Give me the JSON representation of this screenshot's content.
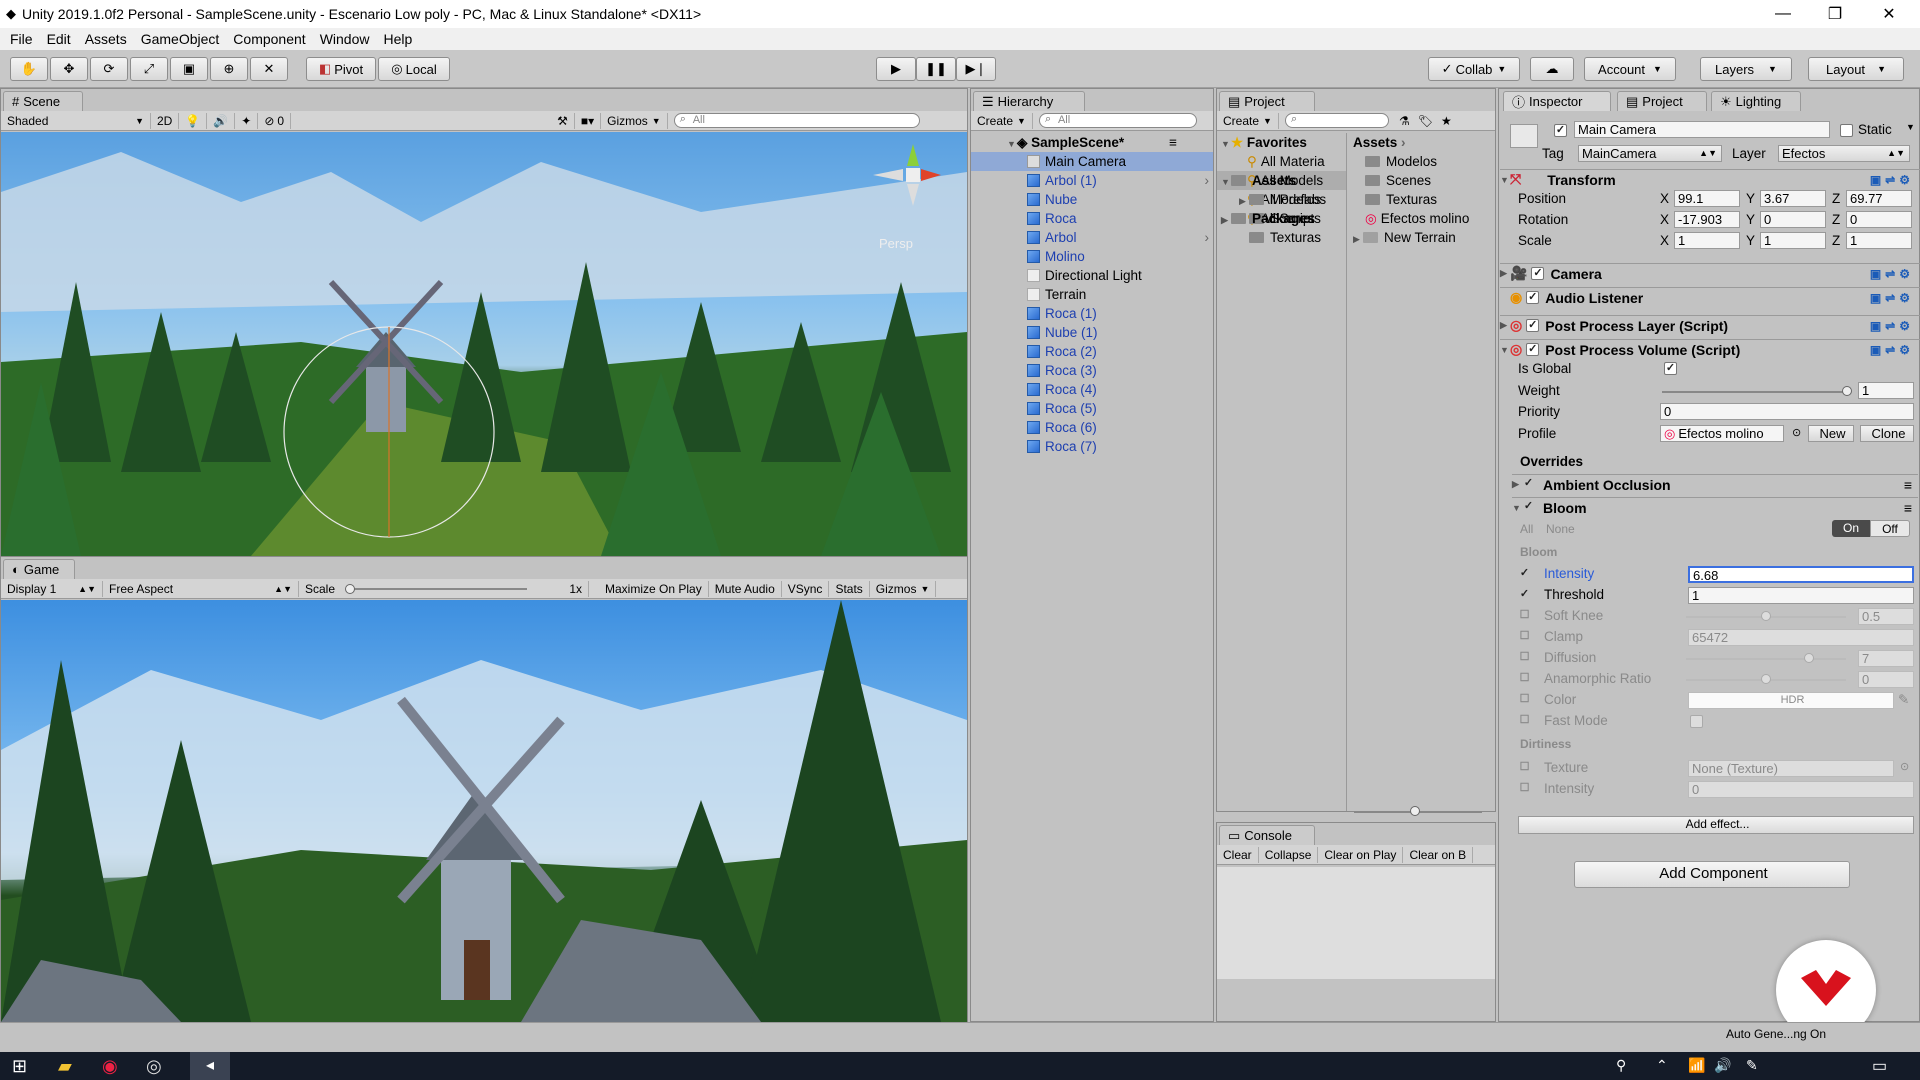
{
  "window": {
    "title": "Unity 2019.1.0f2 Personal - SampleScene.unity - Escenario Low poly - PC, Mac & Linux Standalone* <DX11>",
    "minimize": "—",
    "maximize": "❐",
    "close": "✕"
  },
  "menu": [
    "File",
    "Edit",
    "Assets",
    "GameObject",
    "Component",
    "Window",
    "Help"
  ],
  "toolbar": {
    "pivot": "Pivot",
    "local": "Local",
    "collab": "Collab",
    "account": "Account",
    "layers": "Layers",
    "layout": "Layout"
  },
  "scene": {
    "tab": "Scene",
    "shading": "Shaded",
    "mode2d": "2D",
    "fx_count": "0",
    "gizmos": "Gizmos",
    "search_placeholder": "All",
    "persp": "Persp"
  },
  "game": {
    "tab": "Game",
    "display": "Display 1",
    "aspect": "Free Aspect",
    "scale_label": "Scale",
    "scale_value": "1x",
    "buttons": [
      "Maximize On Play",
      "Mute Audio",
      "VSync",
      "Stats",
      "Gizmos"
    ]
  },
  "hierarchy": {
    "tab": "Hierarchy",
    "create": "Create",
    "search_placeholder": "All",
    "scene": "SampleScene*",
    "items": [
      {
        "label": "Main Camera",
        "type": "camera",
        "selected": true,
        "expand": false
      },
      {
        "label": "Arbol (1)",
        "type": "prefab",
        "expand": true
      },
      {
        "label": "Nube",
        "type": "prefab",
        "expand": false
      },
      {
        "label": "Roca",
        "type": "prefab",
        "expand": false
      },
      {
        "label": "Arbol",
        "type": "prefab",
        "expand": true
      },
      {
        "label": "Molino",
        "type": "prefab",
        "expand": false
      },
      {
        "label": "Directional Light",
        "type": "object",
        "expand": false
      },
      {
        "label": "Terrain",
        "type": "object",
        "expand": false
      },
      {
        "label": "Roca (1)",
        "type": "prefab",
        "expand": false
      },
      {
        "label": "Nube (1)",
        "type": "prefab",
        "expand": false
      },
      {
        "label": "Roca (2)",
        "type": "prefab",
        "expand": false
      },
      {
        "label": "Roca (3)",
        "type": "prefab",
        "expand": false
      },
      {
        "label": "Roca (4)",
        "type": "prefab",
        "expand": false
      },
      {
        "label": "Roca (5)",
        "type": "prefab",
        "expand": false
      },
      {
        "label": "Roca (6)",
        "type": "prefab",
        "expand": false
      },
      {
        "label": "Roca (7)",
        "type": "prefab",
        "expand": false
      }
    ]
  },
  "project": {
    "tab": "Project",
    "create": "Create",
    "favorites": "Favorites",
    "favorite_items": [
      "All Materia",
      "All Models",
      "All Prefabs",
      "All Scripts"
    ],
    "assets_root": "Assets",
    "asset_folders": [
      "Modelos",
      "Scenes",
      "Texturas"
    ],
    "packages": "Packages",
    "breadcrumb": "Assets",
    "grid_items": [
      {
        "label": "Modelos",
        "icon": "folder"
      },
      {
        "label": "Scenes",
        "icon": "folder"
      },
      {
        "label": "Texturas",
        "icon": "folder"
      },
      {
        "label": "Efectos molino",
        "icon": "profile"
      },
      {
        "label": "New Terrain",
        "icon": "terrain"
      }
    ]
  },
  "console": {
    "tab": "Console",
    "buttons": [
      "Clear",
      "Collapse",
      "Clear on Play",
      "Clear on B"
    ]
  },
  "inspector": {
    "tabs": [
      "Inspector",
      "Project",
      "Lighting"
    ],
    "object_name": "Main Camera",
    "static_label": "Static",
    "tag_label": "Tag",
    "tag": "MainCamera",
    "layer_label": "Layer",
    "layer": "Efectos",
    "transform": {
      "title": "Transform",
      "rows": [
        {
          "label": "Position",
          "x": "99.1",
          "y": "3.67",
          "z": "69.77"
        },
        {
          "label": "Rotation",
          "x": "-17.903",
          "y": "0",
          "z": "0"
        },
        {
          "label": "Scale",
          "x": "1",
          "y": "1",
          "z": "1"
        }
      ]
    },
    "components": [
      "Camera",
      "Audio Listener",
      "Post Process Layer (Script)"
    ],
    "ppv": {
      "title": "Post Process Volume (Script)",
      "is_global": "Is Global",
      "weight_label": "Weight",
      "weight": "1",
      "priority_label": "Priority",
      "priority": "0",
      "profile_label": "Profile",
      "profile": "Efectos molino",
      "new": "New",
      "clone": "Clone"
    },
    "overrides": "Overrides",
    "ao": "Ambient Occlusion",
    "bloom": "Bloom",
    "all": "All",
    "none": "None",
    "on": "On",
    "off": "Off",
    "bloom_section": "Bloom",
    "bloom_rows": [
      {
        "label": "Intensity",
        "value": "6.68",
        "enabled": true
      },
      {
        "label": "Threshold",
        "value": "1",
        "enabled": true
      },
      {
        "label": "Soft Knee",
        "value": "0.5",
        "enabled": false
      },
      {
        "label": "Clamp",
        "value": "65472",
        "enabled": false
      },
      {
        "label": "Diffusion",
        "value": "7",
        "enabled": false
      },
      {
        "label": "Anamorphic Ratio",
        "value": "0",
        "enabled": false
      },
      {
        "label": "Color",
        "value": "HDR",
        "enabled": false
      },
      {
        "label": "Fast Mode",
        "value": "",
        "enabled": false
      }
    ],
    "dirtiness": "Dirtiness",
    "dirt_rows": [
      {
        "label": "Texture",
        "value": "None (Texture)"
      },
      {
        "label": "Intensity",
        "value": "0"
      }
    ],
    "add_effect": "Add effect...",
    "add_component": "Add Component"
  },
  "statusbar": {
    "text": "Auto Gene...ng On"
  }
}
